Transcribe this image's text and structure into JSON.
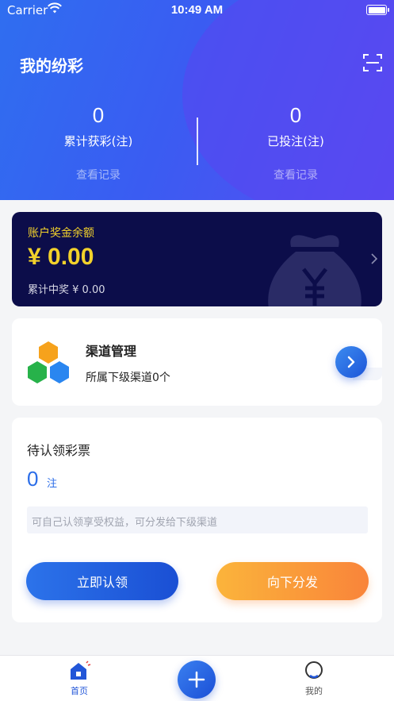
{
  "status_bar": {
    "carrier": "Carrier",
    "time": "10:49 AM"
  },
  "header": {
    "title": "我的纷彩",
    "stats": [
      {
        "value": "0",
        "label": "累计获彩(注)",
        "link": "查看记录"
      },
      {
        "value": "0",
        "label": "已投注(注)",
        "link": "查看记录"
      }
    ]
  },
  "balance_card": {
    "title": "账户奖金余额",
    "amount": "¥ 0.00",
    "total_winnings": "累计中奖 ¥ 0.00"
  },
  "channel_card": {
    "title": "渠道管理",
    "subtitle": "所属下级渠道0个"
  },
  "pending_card": {
    "title": "待认领彩票",
    "count": "0",
    "unit": "注",
    "note": "可自己认领享受权益，可分发给下级渠道",
    "claim_button": "立即认领",
    "distribute_button": "向下分发"
  },
  "tab_bar": {
    "home_label": "首页",
    "mine_label": "我的",
    "active_color": "#2256d8"
  },
  "colors": {
    "header_gradient_start": "#2f6ef0",
    "header_gradient_end": "#5a4cf2",
    "balance_bg": "#0c0d4a",
    "gold": "#f2d12b",
    "accent_blue": "#2b6de8",
    "accent_orange": "#f9843a"
  },
  "icons": [
    "wifi-icon",
    "battery-icon",
    "scan-icon",
    "money-bag-icon",
    "chevron-right-icon",
    "hexagon-logo-icon",
    "arrow-right-icon",
    "home-icon",
    "plus-icon",
    "user-icon"
  ]
}
